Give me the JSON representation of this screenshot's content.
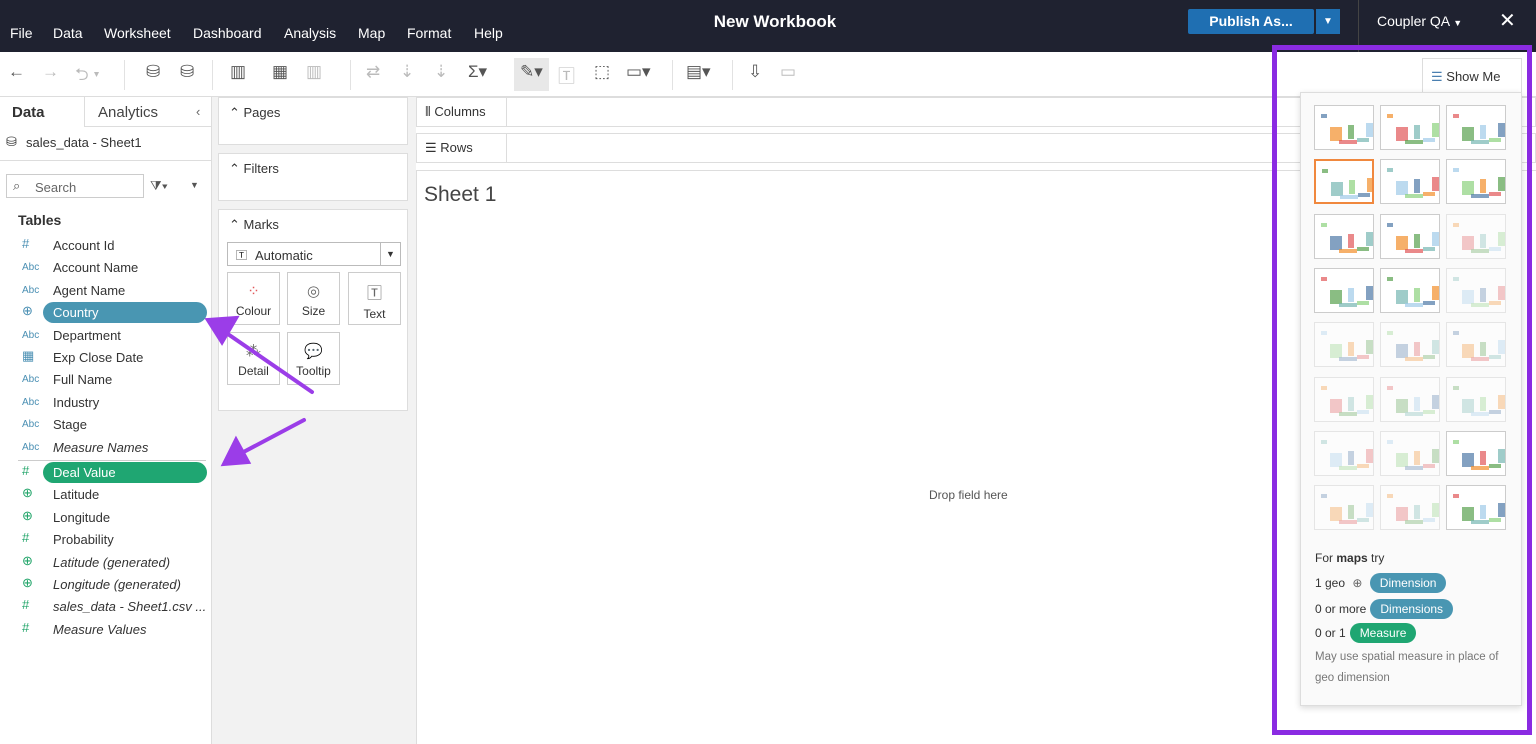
{
  "app": {
    "title": "New Workbook",
    "publish_label": "Publish As...",
    "user": "Coupler QA",
    "menu": [
      "File",
      "Data",
      "Worksheet",
      "Dashboard",
      "Analysis",
      "Map",
      "Format",
      "Help"
    ]
  },
  "left_panel": {
    "tabs": [
      "Data",
      "Analytics"
    ],
    "datasource": "sales_data - Sheet1",
    "search_placeholder": "Search",
    "tables_heading": "Tables",
    "dimensions": [
      {
        "type": "#",
        "label": "Account Id"
      },
      {
        "type": "Abc",
        "label": "Account Name"
      },
      {
        "type": "Abc",
        "label": "Agent Name"
      },
      {
        "type": "globe",
        "label": "Country",
        "highlighted": true
      },
      {
        "type": "Abc",
        "label": "Department"
      },
      {
        "type": "date",
        "label": "Exp Close Date"
      },
      {
        "type": "Abc",
        "label": "Full Name"
      },
      {
        "type": "Abc",
        "label": "Industry"
      },
      {
        "type": "Abc",
        "label": "Stage"
      },
      {
        "type": "Abc",
        "label": "Measure Names",
        "italic": true
      }
    ],
    "measures": [
      {
        "type": "#",
        "label": "Deal Value",
        "highlighted": true
      },
      {
        "type": "globe",
        "label": "Latitude"
      },
      {
        "type": "globe",
        "label": "Longitude"
      },
      {
        "type": "#",
        "label": "Probability"
      },
      {
        "type": "globe",
        "label": "Latitude (generated)",
        "italic": true
      },
      {
        "type": "globe",
        "label": "Longitude (generated)",
        "italic": true
      },
      {
        "type": "#",
        "label": "sales_data - Sheet1.csv ...",
        "italic": true
      },
      {
        "type": "#",
        "label": "Measure Values",
        "italic": true
      }
    ]
  },
  "cards": {
    "pages": "Pages",
    "filters": "Filters",
    "marks": "Marks",
    "mark_type": "Automatic",
    "mark_buttons": [
      "Colour",
      "Size",
      "Text",
      "Detail",
      "Tooltip"
    ]
  },
  "shelves": {
    "columns": "Columns",
    "rows": "Rows"
  },
  "canvas": {
    "sheet_title": "Sheet 1",
    "drop_hint": "Drop field here"
  },
  "show_me": {
    "tab_label": "Show Me",
    "selected_index": 3,
    "charts": [
      "text-table",
      "heat-map",
      "highlight-table",
      "symbol-map",
      "filled-map",
      "pie",
      "horizontal-bars",
      "stacked-bars",
      "side-by-side-bars",
      "treemap",
      "circle-views",
      "side-by-side-circles",
      "lines-continuous",
      "lines-discrete",
      "dual-lines",
      "area-continuous",
      "area-discrete",
      "dual-combination",
      "scatter",
      "histogram",
      "box-whisker",
      "gantt",
      "bullet",
      "packed-bubbles"
    ],
    "hint_title_pre": "For ",
    "hint_title_bold": "maps",
    "hint_title_post": " try",
    "req1_label": "1 geo",
    "req1_badge": "Dimension",
    "req2_label": "0 or more",
    "req2_badge": "Dimensions",
    "req3_label": "0 or 1",
    "req3_badge": "Measure",
    "note": "May use spatial measure in place of geo dimension"
  },
  "colors": {
    "dimension": "#4996b2",
    "measure": "#1fa672",
    "highlight": "#8a2be2",
    "topbar": "#1f2230"
  }
}
